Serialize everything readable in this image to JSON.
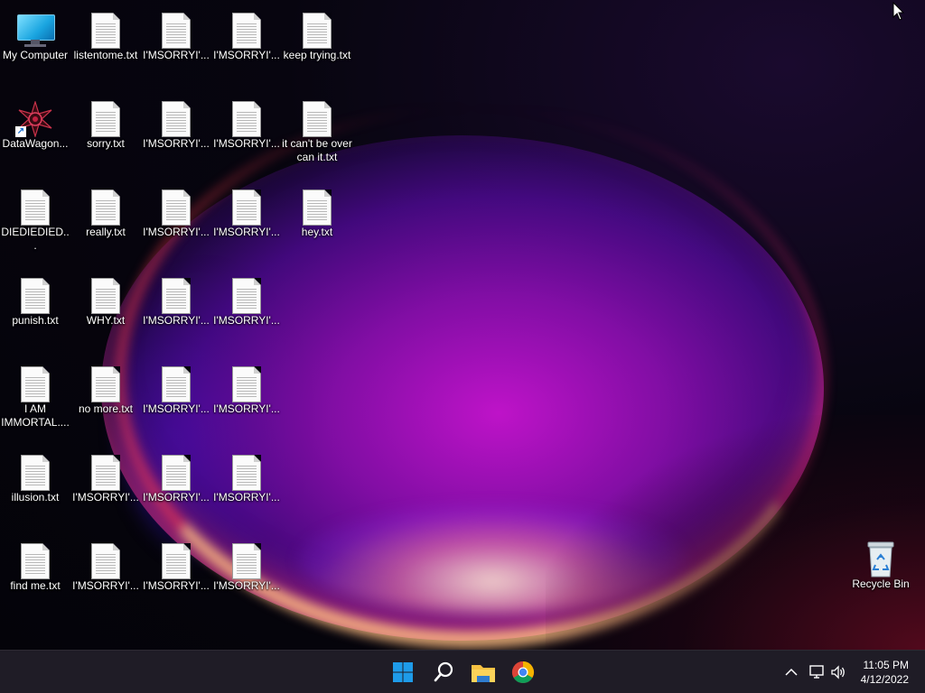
{
  "desktop": {
    "col1": [
      {
        "label": "My Computer",
        "type": "computer"
      },
      {
        "label": "DataWagon...",
        "type": "shortcut"
      },
      {
        "label": "DIEDIEDIED...",
        "type": "txt"
      },
      {
        "label": "punish.txt",
        "type": "txt"
      },
      {
        "label": "I AM IMMORTAL....",
        "type": "txt"
      },
      {
        "label": "illusion.txt",
        "type": "txt"
      },
      {
        "label": "find me.txt",
        "type": "txt"
      }
    ],
    "col2": [
      {
        "label": "listentome.txt",
        "type": "txt"
      },
      {
        "label": "sorry.txt",
        "type": "txt"
      },
      {
        "label": "really.txt",
        "type": "txt"
      },
      {
        "label": "WHY.txt",
        "type": "txt"
      },
      {
        "label": "no more.txt",
        "type": "txt"
      },
      {
        "label": "I'MSORRYI'...",
        "type": "txt"
      },
      {
        "label": "I'MSORRYI'...",
        "type": "txt"
      }
    ],
    "col3": [
      {
        "label": "I'MSORRYI'...",
        "type": "txt"
      },
      {
        "label": "I'MSORRYI'...",
        "type": "txt"
      },
      {
        "label": "I'MSORRYI'...",
        "type": "txt"
      },
      {
        "label": "I'MSORRYI'...",
        "type": "txt"
      },
      {
        "label": "I'MSORRYI'...",
        "type": "txt"
      },
      {
        "label": "I'MSORRYI'...",
        "type": "txt"
      },
      {
        "label": "I'MSORRYI'...",
        "type": "txt"
      }
    ],
    "col4": [
      {
        "label": "I'MSORRYI'...",
        "type": "txt"
      },
      {
        "label": "I'MSORRYI'...",
        "type": "txt"
      },
      {
        "label": "I'MSORRYI'...",
        "type": "txt"
      },
      {
        "label": "I'MSORRYI'...",
        "type": "txt"
      },
      {
        "label": "I'MSORRYI'...",
        "type": "txt"
      },
      {
        "label": "I'MSORRYI'...",
        "type": "txt"
      },
      {
        "label": "I'MSORRYI'...",
        "type": "txt"
      }
    ],
    "col5": [
      {
        "label": "keep trying.txt",
        "type": "txt"
      },
      {
        "label": "it can't be over can it.txt",
        "type": "txt"
      },
      {
        "label": "hey.txt",
        "type": "txt"
      }
    ],
    "recycle_bin": {
      "label": "Recycle Bin"
    }
  },
  "taskbar": {
    "pinned": [
      {
        "name": "start",
        "icon": "windows-logo-icon"
      },
      {
        "name": "search",
        "icon": "search-icon"
      },
      {
        "name": "file-explorer",
        "icon": "folder-icon"
      },
      {
        "name": "chrome",
        "icon": "chrome-icon"
      }
    ],
    "clock": {
      "time": "11:05 PM",
      "date": "4/12/2022"
    }
  },
  "colors": {
    "taskbar_bg": "#1f1c26",
    "windows_blue": "#1e9be9",
    "folder_yellow": "#f6c142"
  }
}
